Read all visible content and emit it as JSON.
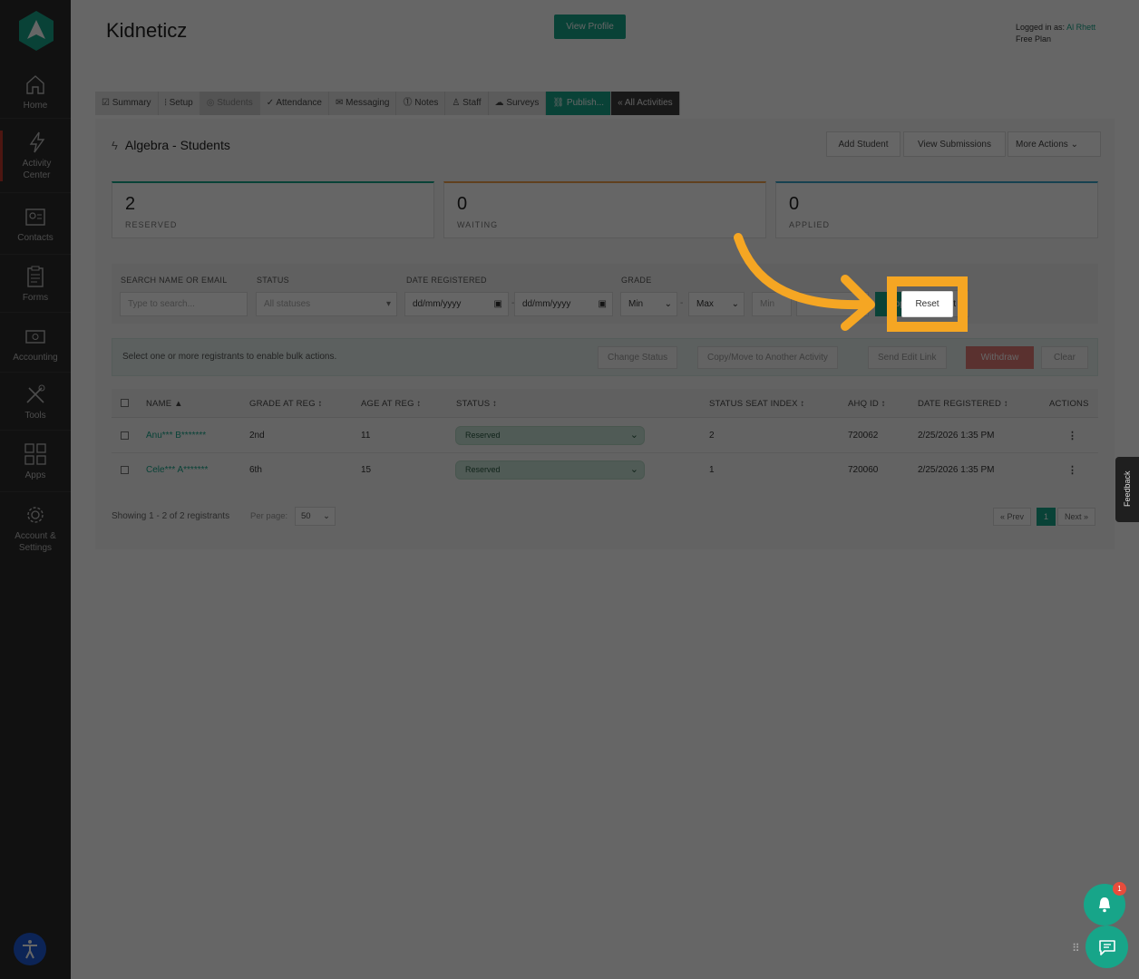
{
  "sidebar": {
    "items": [
      {
        "label": "Home",
        "icon": "home-icon"
      },
      {
        "label": "Activity\nCenter",
        "icon": "bolt-icon"
      },
      {
        "label": "Contacts",
        "icon": "contacts-icon"
      },
      {
        "label": "Forms",
        "icon": "clipboard-icon"
      },
      {
        "label": "Accounting",
        "icon": "cash-icon"
      },
      {
        "label": "Tools",
        "icon": "tools-icon"
      },
      {
        "label": "Apps",
        "icon": "apps-grid-icon"
      },
      {
        "label": "Account &\nSettings",
        "icon": "gear-icon"
      }
    ]
  },
  "header": {
    "org_name": "Kidneticz",
    "view_profile": "View Profile",
    "logged_in_prefix": "Logged in as:",
    "user_name": "Al Rhett",
    "plan": "Free Plan"
  },
  "tabs": [
    {
      "label": "Summary",
      "icon": "☑"
    },
    {
      "label": "Setup",
      "icon": "⦙"
    },
    {
      "label": "Students",
      "icon": "◎"
    },
    {
      "label": "Attendance",
      "icon": "✓"
    },
    {
      "label": "Messaging",
      "icon": "✉"
    },
    {
      "label": "Notes",
      "icon": "⓵"
    },
    {
      "label": "Staff",
      "icon": "♙"
    },
    {
      "label": "Surveys",
      "icon": "☁"
    },
    {
      "label": "Publish...",
      "icon": "⛓"
    },
    {
      "label": "« All Activities",
      "icon": ""
    }
  ],
  "panel": {
    "title": "Algebra - Students",
    "add_student": "Add Student",
    "view_submissions": "View Submissions",
    "more_actions": "More Actions"
  },
  "stats": [
    {
      "value": "2",
      "label": "RESERVED",
      "color": "#17a589"
    },
    {
      "value": "0",
      "label": "WAITING",
      "color": "#f0a04b"
    },
    {
      "value": "0",
      "label": "APPLIED",
      "color": "#3aa3c9"
    }
  ],
  "filters": {
    "search_label": "SEARCH NAME OR EMAIL",
    "search_placeholder": "Type to search...",
    "status_label": "STATUS",
    "status_value": "All statuses",
    "date_label": "DATE REGISTERED",
    "date_from": "dd/mm/yyyy",
    "date_to": "dd/mm/yyyy",
    "grade_label": "GRADE",
    "grade_min": "Min",
    "grade_max": "Max",
    "age_min": "Min",
    "apply": "Apply",
    "reset": "Reset"
  },
  "bulk": {
    "message": "Select one or more registrants to enable bulk actions.",
    "change_status": "Change Status",
    "copy_move": "Copy/Move to Another Activity",
    "send_edit_link": "Send Edit Link",
    "withdraw": "Withdraw",
    "clear": "Clear"
  },
  "table": {
    "columns": [
      "NAME ▲",
      "GRADE AT REG ↕",
      "AGE AT REG ↕",
      "STATUS ↕",
      "STATUS SEAT INDEX ↕",
      "AHQ ID ↕",
      "DATE REGISTERED ↕",
      "ACTIONS"
    ],
    "rows": [
      {
        "name": "Anu*** B*******",
        "grade": "2nd",
        "age": "11",
        "status": "Reserved",
        "seat": "2",
        "ahq": "720062",
        "date": "2/25/2026 1:35 PM"
      },
      {
        "name": "Cele*** A*******",
        "grade": "6th",
        "age": "15",
        "status": "Reserved",
        "seat": "1",
        "ahq": "720060",
        "date": "2/25/2026 1:35 PM"
      }
    ]
  },
  "footer": {
    "showing": "Showing 1 - 2 of 2 registrants",
    "per_page_label": "Per page:",
    "per_page_value": "50",
    "prev": "« Prev",
    "page": "1",
    "next": "Next »"
  },
  "widgets": {
    "feedback": "Feedback",
    "notification_count": "1"
  },
  "colors": {
    "accent": "#17a589",
    "highlight": "#f5a623",
    "sidebar": "#2b2b2b"
  }
}
